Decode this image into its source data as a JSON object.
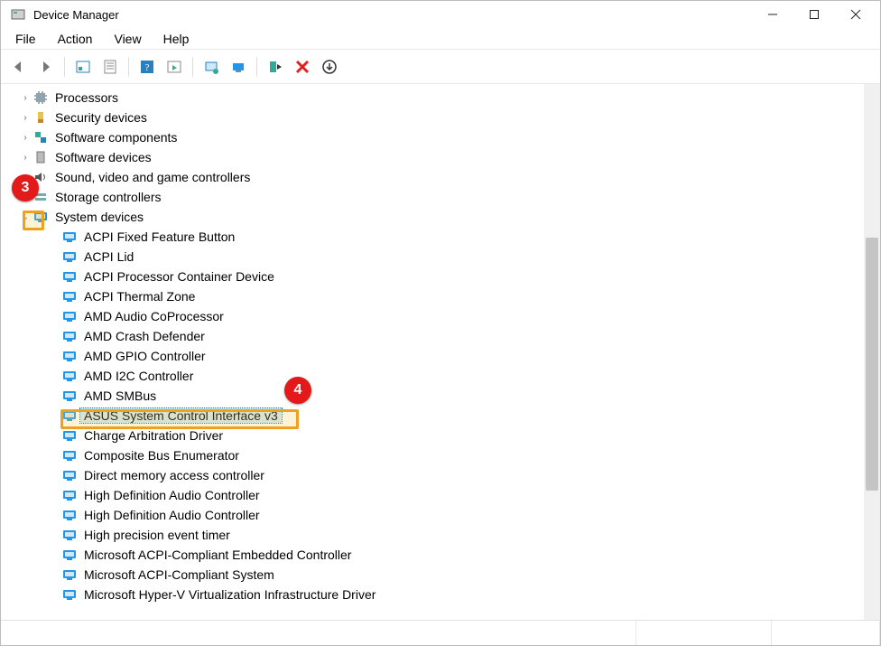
{
  "window": {
    "title": "Device Manager"
  },
  "menubar": {
    "file": "File",
    "action": "Action",
    "view": "View",
    "help": "Help"
  },
  "annotations": {
    "callout3": "3",
    "callout4": "4"
  },
  "tree": {
    "categories": [
      {
        "label": "Processors",
        "icon": "processor-icon",
        "expanded": false
      },
      {
        "label": "Security devices",
        "icon": "security-icon",
        "expanded": false
      },
      {
        "label": "Software components",
        "icon": "software-component-icon",
        "expanded": false
      },
      {
        "label": "Software devices",
        "icon": "software-device-icon",
        "expanded": false
      },
      {
        "label": "Sound, video and game controllers",
        "icon": "sound-icon",
        "expanded": false
      },
      {
        "label": "Storage controllers",
        "icon": "storage-icon",
        "expanded": false
      },
      {
        "label": "System devices",
        "icon": "system-device-icon",
        "expanded": true,
        "highlighted_expander": true,
        "children": [
          {
            "label": "ACPI Fixed Feature Button"
          },
          {
            "label": "ACPI Lid"
          },
          {
            "label": "ACPI Processor Container Device"
          },
          {
            "label": "ACPI Thermal Zone"
          },
          {
            "label": "AMD Audio CoProcessor"
          },
          {
            "label": "AMD Crash Defender"
          },
          {
            "label": "AMD GPIO Controller"
          },
          {
            "label": "AMD I2C Controller"
          },
          {
            "label": "AMD SMBus"
          },
          {
            "label": "ASUS System Control Interface v3",
            "selected": true,
            "highlighted": true
          },
          {
            "label": "Charge Arbitration Driver"
          },
          {
            "label": "Composite Bus Enumerator"
          },
          {
            "label": "Direct memory access controller"
          },
          {
            "label": "High Definition Audio Controller"
          },
          {
            "label": "High Definition Audio Controller"
          },
          {
            "label": "High precision event timer"
          },
          {
            "label": "Microsoft ACPI-Compliant Embedded Controller"
          },
          {
            "label": "Microsoft ACPI-Compliant System"
          },
          {
            "label": "Microsoft Hyper-V Virtualization Infrastructure Driver"
          }
        ]
      }
    ]
  }
}
